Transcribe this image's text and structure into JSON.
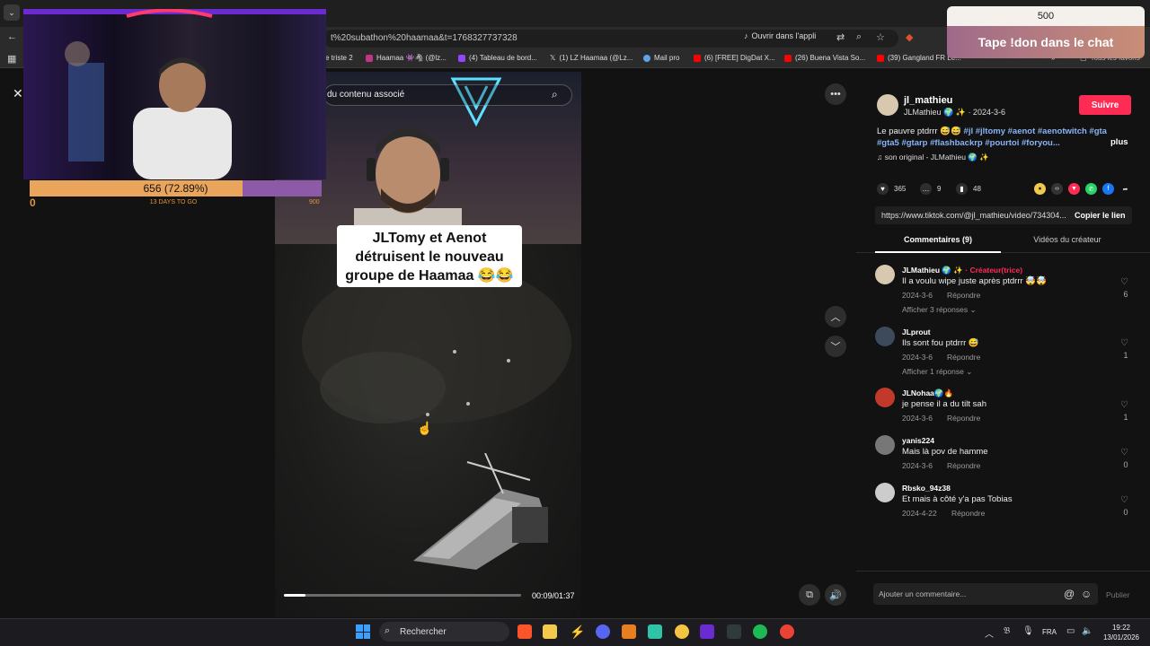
{
  "browser": {
    "url_partial": "t%20subathon%20haamaa&t=1768327737328",
    "open_in_app": "Ouvrir dans l'appli",
    "bookmarks": [
      {
        "label": "e triste 2",
        "color": "#888"
      },
      {
        "label": "Haamaa 👾🦓 (@lz...",
        "color": "#c13584"
      },
      {
        "label": "(4) Tableau de bord...",
        "color": "#9146ff"
      },
      {
        "label": "(1) LZ Haamaa (@Lz...",
        "color": "#000000"
      },
      {
        "label": "Mail pro",
        "color": "#5ba4e5"
      },
      {
        "label": "(6) [FREE] DigDat X...",
        "color": "#ff0000"
      },
      {
        "label": "(26) Buena Vista So...",
        "color": "#ff0000"
      },
      {
        "label": "(39) Gangland FR Le...",
        "color": "#ff0000"
      }
    ],
    "all_favorites": "Tous les favoris"
  },
  "video": {
    "search_overlay": "du contenu associé",
    "caption": "JLTomy et Aenot détruisent le nouveau groupe de Haamaa 😂😂",
    "time": "00:09/01:37",
    "progress": 0.09
  },
  "stream_overlay": {
    "sub_goal_text": "656 (72.89%)",
    "sub_goal_progress": 0.7289,
    "sub_min": "0",
    "sub_days": "13 DAYS TO GO",
    "sub_max": "900",
    "donate_amount": "500",
    "donate_cta": "Tape !don dans le chat"
  },
  "post": {
    "username": "jl_mathieu",
    "nickname": "JLMathieu 🌍 ✨ · 2024-3-6",
    "follow_label": "Suivre",
    "desc_text": "Le pauvre ptdrrr 😅😅 ",
    "desc_tags": "#jl #jltomy #aenot #aenotwitch #gta #gta5 #gtarp #flashbackrp #pourtoi #foryou...",
    "more_label": "plus",
    "music": "♫  son original - JLMathieu 🌍 ✨",
    "likes": "365",
    "comments": "9",
    "saves": "48",
    "share_url": "https://www.tiktok.com/@jl_mathieu/video/734304...",
    "copy_label": "Copier le lien",
    "tab_comments": "Commentaires (9)",
    "tab_videos": "Vidéos du créateur"
  },
  "comments": [
    {
      "name": "JLMathieu 🌍 ✨",
      "badge": " · Créateur(trice)",
      "text": "Il a voulu wipe juste après ptdrrr 🤯🤯",
      "date": "2024-3-6",
      "likes": "6",
      "replies": "Afficher 3 réponses ⌄",
      "avatar": "#d9c8b0"
    },
    {
      "name": "JLprout",
      "badge": "",
      "text": "Ils sont fou ptdrrr 😅",
      "date": "2024-3-6",
      "likes": "1",
      "replies": "Afficher 1 réponse ⌄",
      "avatar": "#3d4a5c"
    },
    {
      "name": "JLNohaa🌍🔥",
      "badge": "",
      "text": "je pense il a du tilt sah",
      "date": "2024-3-6",
      "likes": "1",
      "replies": "",
      "avatar": "#c0392b"
    },
    {
      "name": "yanis224",
      "badge": "",
      "text": "Mais là pov de hamme",
      "date": "2024-3-6",
      "likes": "0",
      "replies": "",
      "avatar": "#777"
    },
    {
      "name": "Rbsko_94z38",
      "badge": "",
      "text": "Et mais à côté y'a pas Tobias",
      "date": "2024-4-22",
      "likes": "0",
      "replies": "",
      "avatar": "#ccc"
    }
  ],
  "reply_label": "Répondre",
  "comment_input": {
    "placeholder": "Ajouter un commentaire...",
    "publish": "Publier"
  },
  "taskbar": {
    "search": "Rechercher",
    "lang": "FRA",
    "time": "19:22",
    "date": "13/01/2026"
  }
}
